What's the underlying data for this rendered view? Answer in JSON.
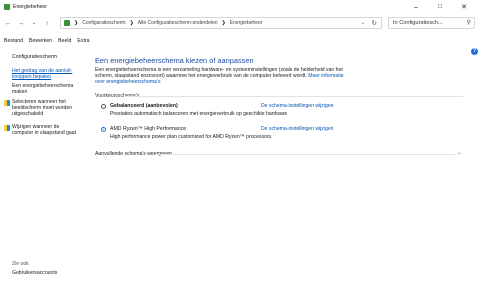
{
  "window": {
    "title": "Energiebeheer"
  },
  "addressbar": {
    "crumbs": [
      "Configuratiescherm",
      "Alle Configuratiescherm-onderdelen",
      "Energiebeheer"
    ],
    "search_placeholder": "In Configuratiesch..."
  },
  "menu": [
    "Bestand",
    "Bewerken",
    "Beeld",
    "Extra"
  ],
  "sidebar": {
    "home": "Configuratiescherm",
    "links": [
      "Het gedrag van de aan/uit-knoppen bepalen",
      "Een energiebeheerschema maken",
      "Selecteren wanneer het beeldscherm moet worden uitgeschakeld",
      "Wijzigen wanneer de computer in slaapstand gaat"
    ],
    "see_also": "Zie ook",
    "accounts": "Gebruikersaccounts"
  },
  "main": {
    "heading": "Een energiebeheerschema kiezen of aanpassen",
    "description": "Een energiebeheerschema is een verzameling hardware- en systeeminstellingen (zoals de helderheid van het scherm, slaapstand enzovoort) waarmee het energieverbruik van de computer beheerd wordt.",
    "more_link": "Meer informatie over energiebeheerschema's",
    "group_label": "Voorkeursschema's",
    "plans": [
      {
        "name": "Gebalanceerd (aanbevolen)",
        "desc": "Prestaties automatisch balanceren met energieverbruik op geschikte hardware",
        "link": "De schema-instellingen wijzigen",
        "selected": false
      },
      {
        "name": "AMD Ryzen™ High Performance",
        "desc": "High performance power plan customized for AMD Ryzen™ processors.",
        "link": "De schema-instellingen wijzigen",
        "selected": true
      }
    ],
    "extra": "Aanvullende schema's weergeven"
  }
}
